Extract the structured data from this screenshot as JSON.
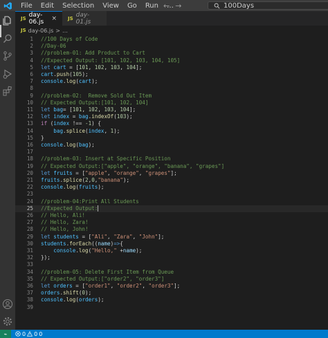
{
  "menu": [
    "File",
    "Edit",
    "Selection",
    "View",
    "Go",
    "Run",
    "…"
  ],
  "search": {
    "text": "100Days"
  },
  "nav": {
    "back": "←",
    "forward": "→"
  },
  "tabs": [
    {
      "badge": "JS",
      "label": "day-06.js",
      "close": "×"
    },
    {
      "badge": "JS",
      "label": "day-01.js"
    }
  ],
  "breadcrumb": {
    "badge": "JS",
    "file": "day-06.js",
    "sep": ">",
    "rest": "…"
  },
  "editor": {
    "current_line": 25,
    "lines": [
      {
        "n": "1",
        "tokens": [
          [
            "c-comment",
            "//100 Days of Code"
          ]
        ]
      },
      {
        "n": "2",
        "tokens": [
          [
            "c-comment",
            "//Day-06"
          ]
        ]
      },
      {
        "n": "3",
        "tokens": [
          [
            "c-comment",
            "//problem-01: Add Product to Cart"
          ]
        ]
      },
      {
        "n": "4",
        "tokens": [
          [
            "c-comment",
            "//Expected Output: [101, 102, 103, 104, 105]"
          ]
        ]
      },
      {
        "n": "5",
        "tokens": [
          [
            "c-kw",
            "let "
          ],
          [
            "c-var",
            "cart"
          ],
          [
            "c-default",
            " = ["
          ],
          [
            "c-num",
            "101"
          ],
          [
            "c-default",
            ", "
          ],
          [
            "c-num",
            "102"
          ],
          [
            "c-default",
            ", "
          ],
          [
            "c-num",
            "103"
          ],
          [
            "c-default",
            ", "
          ],
          [
            "c-num",
            "104"
          ],
          [
            "c-default",
            "];"
          ]
        ]
      },
      {
        "n": "6",
        "tokens": [
          [
            "c-var",
            "cart"
          ],
          [
            "c-default",
            "."
          ],
          [
            "c-fn",
            "push"
          ],
          [
            "c-default",
            "("
          ],
          [
            "c-num",
            "105"
          ],
          [
            "c-default",
            ");"
          ]
        ]
      },
      {
        "n": "7",
        "tokens": [
          [
            "c-var",
            "console"
          ],
          [
            "c-default",
            "."
          ],
          [
            "c-fn",
            "log"
          ],
          [
            "c-default",
            "("
          ],
          [
            "c-var",
            "cart"
          ],
          [
            "c-default",
            ");"
          ]
        ]
      },
      {
        "n": "8",
        "tokens": []
      },
      {
        "n": "9",
        "tokens": [
          [
            "c-comment",
            "//problem-02:  Remove Sold Out Item"
          ]
        ]
      },
      {
        "n": "10",
        "tokens": [
          [
            "c-comment",
            "// Expected Output:[101, 102, 104]"
          ]
        ]
      },
      {
        "n": "11",
        "tokens": [
          [
            "c-kw",
            "let "
          ],
          [
            "c-var",
            "bag"
          ],
          [
            "c-default",
            "= ["
          ],
          [
            "c-num",
            "101"
          ],
          [
            "c-default",
            ", "
          ],
          [
            "c-num",
            "102"
          ],
          [
            "c-default",
            ", "
          ],
          [
            "c-num",
            "103"
          ],
          [
            "c-default",
            ", "
          ],
          [
            "c-num",
            "104"
          ],
          [
            "c-default",
            "];"
          ]
        ]
      },
      {
        "n": "12",
        "tokens": [
          [
            "c-kw",
            "let "
          ],
          [
            "c-var",
            "index"
          ],
          [
            "c-default",
            " = "
          ],
          [
            "c-var",
            "bag"
          ],
          [
            "c-default",
            "."
          ],
          [
            "c-fn",
            "indexOf"
          ],
          [
            "c-default",
            "("
          ],
          [
            "c-num",
            "103"
          ],
          [
            "c-default",
            ");"
          ]
        ]
      },
      {
        "n": "13",
        "tokens": [
          [
            "c-ctl",
            "if "
          ],
          [
            "c-default",
            "("
          ],
          [
            "c-var",
            "index"
          ],
          [
            "c-default",
            " !== "
          ],
          [
            "c-num",
            "-1"
          ],
          [
            "c-default",
            ") {"
          ]
        ]
      },
      {
        "n": "14",
        "tokens": [
          [
            "c-default",
            "    "
          ],
          [
            "c-var",
            "bag"
          ],
          [
            "c-default",
            "."
          ],
          [
            "c-fn",
            "splice"
          ],
          [
            "c-default",
            "("
          ],
          [
            "c-var",
            "index"
          ],
          [
            "c-default",
            ", "
          ],
          [
            "c-num",
            "1"
          ],
          [
            "c-default",
            ");"
          ]
        ]
      },
      {
        "n": "15",
        "tokens": [
          [
            "c-default",
            "}"
          ]
        ]
      },
      {
        "n": "16",
        "tokens": [
          [
            "c-var",
            "console"
          ],
          [
            "c-default",
            "."
          ],
          [
            "c-fn",
            "log"
          ],
          [
            "c-default",
            "("
          ],
          [
            "c-var",
            "bag"
          ],
          [
            "c-default",
            ");"
          ]
        ]
      },
      {
        "n": "17",
        "tokens": []
      },
      {
        "n": "18",
        "tokens": [
          [
            "c-comment",
            "//problem-03: Insert at Specific Position"
          ]
        ]
      },
      {
        "n": "19",
        "tokens": [
          [
            "c-comment",
            "// Expected Output:[\"apple\", \"orange\", \"banana\", \"grapes\"]"
          ]
        ]
      },
      {
        "n": "20",
        "tokens": [
          [
            "c-kw",
            "let "
          ],
          [
            "c-var",
            "fruits"
          ],
          [
            "c-default",
            " = ["
          ],
          [
            "c-str",
            "\"apple\""
          ],
          [
            "c-default",
            ", "
          ],
          [
            "c-str",
            "\"orange\""
          ],
          [
            "c-default",
            ", "
          ],
          [
            "c-str",
            "\"grapes\""
          ],
          [
            "c-default",
            "];"
          ]
        ]
      },
      {
        "n": "21",
        "tokens": [
          [
            "c-var",
            "fruits"
          ],
          [
            "c-default",
            "."
          ],
          [
            "c-fn",
            "splice"
          ],
          [
            "c-default",
            "("
          ],
          [
            "c-num",
            "2"
          ],
          [
            "c-default",
            ","
          ],
          [
            "c-num",
            "0"
          ],
          [
            "c-default",
            ","
          ],
          [
            "c-str",
            "\"banana\""
          ],
          [
            "c-default",
            ");"
          ]
        ]
      },
      {
        "n": "22",
        "tokens": [
          [
            "c-var",
            "console"
          ],
          [
            "c-default",
            "."
          ],
          [
            "c-fn",
            "log"
          ],
          [
            "c-default",
            "("
          ],
          [
            "c-var",
            "fruits"
          ],
          [
            "c-default",
            ");"
          ]
        ]
      },
      {
        "n": "23",
        "tokens": []
      },
      {
        "n": "24",
        "tokens": [
          [
            "c-comment",
            "//problem-04:Print All Students"
          ]
        ]
      },
      {
        "n": "25",
        "tokens": [
          [
            "c-comment",
            "//Expected Output:"
          ]
        ],
        "cursor": true
      },
      {
        "n": "26",
        "tokens": [
          [
            "c-comment",
            "// Hello, Ali!"
          ]
        ]
      },
      {
        "n": "27",
        "tokens": [
          [
            "c-comment",
            "// Hello, Zara!"
          ]
        ]
      },
      {
        "n": "28",
        "tokens": [
          [
            "c-comment",
            "// Hello, John!"
          ]
        ]
      },
      {
        "n": "29",
        "tokens": [
          [
            "c-kw",
            "let "
          ],
          [
            "c-var",
            "students"
          ],
          [
            "c-default",
            " = ["
          ],
          [
            "c-str",
            "\"Ali\""
          ],
          [
            "c-default",
            ", "
          ],
          [
            "c-str",
            "\"Zara\""
          ],
          [
            "c-default",
            ", "
          ],
          [
            "c-str",
            "\"John\""
          ],
          [
            "c-default",
            "];"
          ]
        ]
      },
      {
        "n": "30",
        "tokens": [
          [
            "c-var",
            "students"
          ],
          [
            "c-default",
            "."
          ],
          [
            "c-fn",
            "forEach"
          ],
          [
            "c-default",
            "(("
          ],
          [
            "c-prop",
            "name"
          ],
          [
            "c-default",
            ")"
          ],
          [
            "c-kw",
            "=>"
          ],
          [
            "c-default",
            "{"
          ]
        ]
      },
      {
        "n": "31",
        "tokens": [
          [
            "c-default",
            "    "
          ],
          [
            "c-var",
            "console"
          ],
          [
            "c-default",
            "."
          ],
          [
            "c-fn",
            "log"
          ],
          [
            "c-default",
            "("
          ],
          [
            "c-str",
            "\"Hello,\""
          ],
          [
            "c-default",
            " +"
          ],
          [
            "c-prop",
            "name"
          ],
          [
            "c-default",
            ");"
          ]
        ]
      },
      {
        "n": "32",
        "tokens": [
          [
            "c-default",
            "});"
          ]
        ]
      },
      {
        "n": "33",
        "tokens": []
      },
      {
        "n": "34",
        "tokens": [
          [
            "c-comment",
            "//problem-05: Delete First Item from Queue"
          ]
        ]
      },
      {
        "n": "35",
        "tokens": [
          [
            "c-comment",
            "// Expected Output:[\"order2\", \"order3\"]"
          ]
        ]
      },
      {
        "n": "36",
        "tokens": [
          [
            "c-kw",
            "let "
          ],
          [
            "c-var",
            "orders"
          ],
          [
            "c-default",
            " = ["
          ],
          [
            "c-str",
            "\"order1\""
          ],
          [
            "c-default",
            ", "
          ],
          [
            "c-str",
            "\"order2\""
          ],
          [
            "c-default",
            ", "
          ],
          [
            "c-str",
            "\"order3\""
          ],
          [
            "c-default",
            "];"
          ]
        ]
      },
      {
        "n": "37",
        "tokens": [
          [
            "c-var",
            "orders"
          ],
          [
            "c-default",
            "."
          ],
          [
            "c-fn",
            "shift"
          ],
          [
            "c-default",
            "("
          ],
          [
            "c-num",
            "0"
          ],
          [
            "c-default",
            ");"
          ]
        ]
      },
      {
        "n": "38",
        "tokens": [
          [
            "c-var",
            "console"
          ],
          [
            "c-default",
            "."
          ],
          [
            "c-fn",
            "log"
          ],
          [
            "c-default",
            "("
          ],
          [
            "c-var",
            "orders"
          ],
          [
            "c-default",
            ");"
          ]
        ]
      },
      {
        "n": "39",
        "tokens": []
      }
    ]
  },
  "status": {
    "remote": "⌁",
    "errors": "0",
    "warnings": "0",
    "extra": "0"
  },
  "colors": {
    "accent": "#007acc",
    "activitybar": "#333333",
    "editor_bg": "#1e1e1e",
    "js_badge": "#cbcb41"
  },
  "icons": [
    "vscode-logo-icon",
    "explorer-icon",
    "search-icon",
    "source-control-icon",
    "run-debug-icon",
    "extensions-icon",
    "account-icon",
    "settings-gear-icon",
    "remote-icon",
    "error-icon",
    "warning-icon"
  ]
}
